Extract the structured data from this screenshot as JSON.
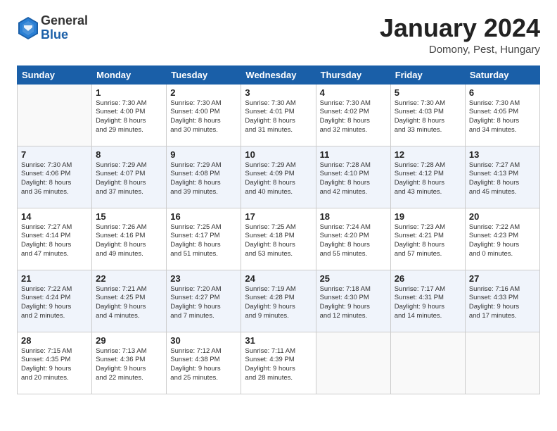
{
  "header": {
    "logo": {
      "general": "General",
      "blue": "Blue"
    },
    "title": "January 2024",
    "location": "Domony, Pest, Hungary"
  },
  "days_of_week": [
    "Sunday",
    "Monday",
    "Tuesday",
    "Wednesday",
    "Thursday",
    "Friday",
    "Saturday"
  ],
  "weeks": [
    [
      {
        "day": "",
        "info": ""
      },
      {
        "day": "1",
        "info": "Sunrise: 7:30 AM\nSunset: 4:00 PM\nDaylight: 8 hours\nand 29 minutes."
      },
      {
        "day": "2",
        "info": "Sunrise: 7:30 AM\nSunset: 4:00 PM\nDaylight: 8 hours\nand 30 minutes."
      },
      {
        "day": "3",
        "info": "Sunrise: 7:30 AM\nSunset: 4:01 PM\nDaylight: 8 hours\nand 31 minutes."
      },
      {
        "day": "4",
        "info": "Sunrise: 7:30 AM\nSunset: 4:02 PM\nDaylight: 8 hours\nand 32 minutes."
      },
      {
        "day": "5",
        "info": "Sunrise: 7:30 AM\nSunset: 4:03 PM\nDaylight: 8 hours\nand 33 minutes."
      },
      {
        "day": "6",
        "info": "Sunrise: 7:30 AM\nSunset: 4:05 PM\nDaylight: 8 hours\nand 34 minutes."
      }
    ],
    [
      {
        "day": "7",
        "info": "Sunrise: 7:30 AM\nSunset: 4:06 PM\nDaylight: 8 hours\nand 36 minutes."
      },
      {
        "day": "8",
        "info": "Sunrise: 7:29 AM\nSunset: 4:07 PM\nDaylight: 8 hours\nand 37 minutes."
      },
      {
        "day": "9",
        "info": "Sunrise: 7:29 AM\nSunset: 4:08 PM\nDaylight: 8 hours\nand 39 minutes."
      },
      {
        "day": "10",
        "info": "Sunrise: 7:29 AM\nSunset: 4:09 PM\nDaylight: 8 hours\nand 40 minutes."
      },
      {
        "day": "11",
        "info": "Sunrise: 7:28 AM\nSunset: 4:10 PM\nDaylight: 8 hours\nand 42 minutes."
      },
      {
        "day": "12",
        "info": "Sunrise: 7:28 AM\nSunset: 4:12 PM\nDaylight: 8 hours\nand 43 minutes."
      },
      {
        "day": "13",
        "info": "Sunrise: 7:27 AM\nSunset: 4:13 PM\nDaylight: 8 hours\nand 45 minutes."
      }
    ],
    [
      {
        "day": "14",
        "info": "Sunrise: 7:27 AM\nSunset: 4:14 PM\nDaylight: 8 hours\nand 47 minutes."
      },
      {
        "day": "15",
        "info": "Sunrise: 7:26 AM\nSunset: 4:16 PM\nDaylight: 8 hours\nand 49 minutes."
      },
      {
        "day": "16",
        "info": "Sunrise: 7:25 AM\nSunset: 4:17 PM\nDaylight: 8 hours\nand 51 minutes."
      },
      {
        "day": "17",
        "info": "Sunrise: 7:25 AM\nSunset: 4:18 PM\nDaylight: 8 hours\nand 53 minutes."
      },
      {
        "day": "18",
        "info": "Sunrise: 7:24 AM\nSunset: 4:20 PM\nDaylight: 8 hours\nand 55 minutes."
      },
      {
        "day": "19",
        "info": "Sunrise: 7:23 AM\nSunset: 4:21 PM\nDaylight: 8 hours\nand 57 minutes."
      },
      {
        "day": "20",
        "info": "Sunrise: 7:22 AM\nSunset: 4:23 PM\nDaylight: 9 hours\nand 0 minutes."
      }
    ],
    [
      {
        "day": "21",
        "info": "Sunrise: 7:22 AM\nSunset: 4:24 PM\nDaylight: 9 hours\nand 2 minutes."
      },
      {
        "day": "22",
        "info": "Sunrise: 7:21 AM\nSunset: 4:25 PM\nDaylight: 9 hours\nand 4 minutes."
      },
      {
        "day": "23",
        "info": "Sunrise: 7:20 AM\nSunset: 4:27 PM\nDaylight: 9 hours\nand 7 minutes."
      },
      {
        "day": "24",
        "info": "Sunrise: 7:19 AM\nSunset: 4:28 PM\nDaylight: 9 hours\nand 9 minutes."
      },
      {
        "day": "25",
        "info": "Sunrise: 7:18 AM\nSunset: 4:30 PM\nDaylight: 9 hours\nand 12 minutes."
      },
      {
        "day": "26",
        "info": "Sunrise: 7:17 AM\nSunset: 4:31 PM\nDaylight: 9 hours\nand 14 minutes."
      },
      {
        "day": "27",
        "info": "Sunrise: 7:16 AM\nSunset: 4:33 PM\nDaylight: 9 hours\nand 17 minutes."
      }
    ],
    [
      {
        "day": "28",
        "info": "Sunrise: 7:15 AM\nSunset: 4:35 PM\nDaylight: 9 hours\nand 20 minutes."
      },
      {
        "day": "29",
        "info": "Sunrise: 7:13 AM\nSunset: 4:36 PM\nDaylight: 9 hours\nand 22 minutes."
      },
      {
        "day": "30",
        "info": "Sunrise: 7:12 AM\nSunset: 4:38 PM\nDaylight: 9 hours\nand 25 minutes."
      },
      {
        "day": "31",
        "info": "Sunrise: 7:11 AM\nSunset: 4:39 PM\nDaylight: 9 hours\nand 28 minutes."
      },
      {
        "day": "",
        "info": ""
      },
      {
        "day": "",
        "info": ""
      },
      {
        "day": "",
        "info": ""
      }
    ]
  ]
}
